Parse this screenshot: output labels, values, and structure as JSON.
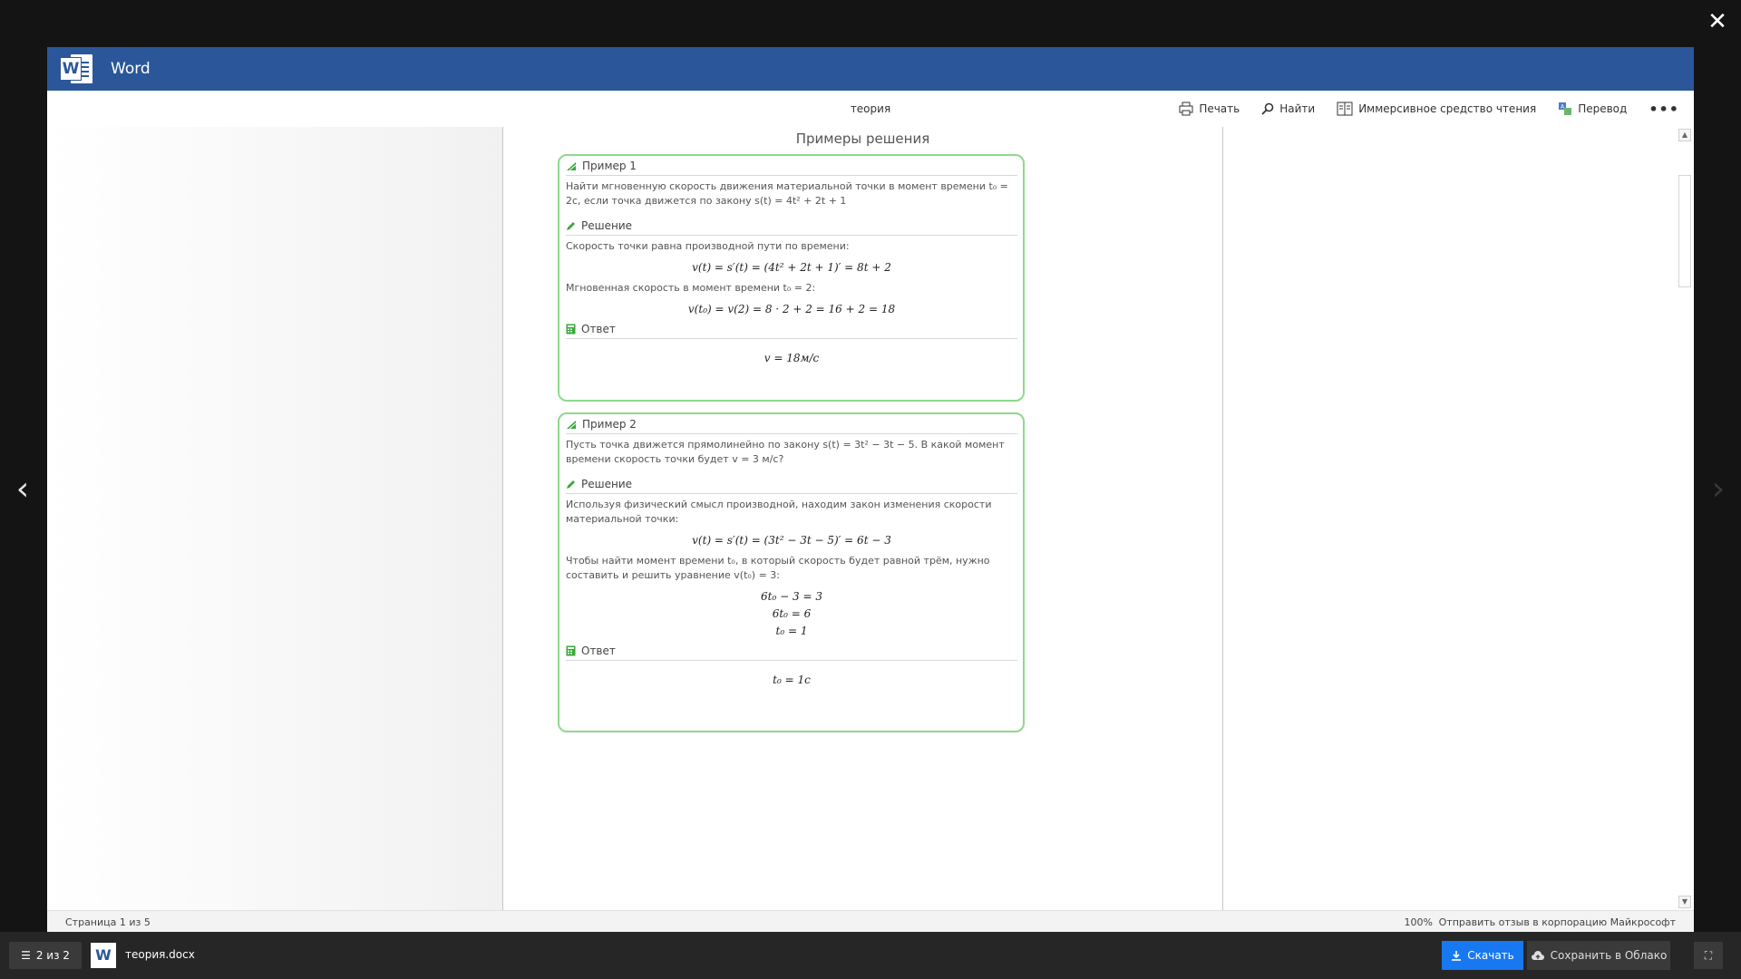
{
  "viewer": {
    "app_name": "Word",
    "doc_title": "теория",
    "toolbar": {
      "print_label": "Печать",
      "find_label": "Найти",
      "immersive_label": "Иммерсивное средство чтения",
      "translate_label": "Перевод",
      "more_label": "•••"
    }
  },
  "document": {
    "section_title": "Примеры решения",
    "example1": {
      "title": "Пример 1",
      "problem": "Найти мгновенную скорость движения материальной точки в момент времени t₀ = 2c, если точка движется по закону s(t) = 4t² + 2t + 1",
      "solution_title": "Решение",
      "step1": "Скорость точки равна производной пути по времени:",
      "formula1": "v(t) = s′(t) = (4t² + 2t + 1)′ = 8t + 2",
      "step2": "Мгновенная скорость в момент времени t₀ = 2:",
      "formula2": "v(t₀) = v(2) = 8 · 2 + 2 = 16 + 2 = 18",
      "answer_title": "Ответ",
      "answer": "v = 18м/с"
    },
    "example2": {
      "title": "Пример 2",
      "problem": "Пусть точка движется прямолинейно по закону s(t) = 3t² − 3t − 5. В какой момент времени скорость точки будет v = 3 м/с?",
      "solution_title": "Решение",
      "step1": "Используя физический смысл производной, находим закон изменения скорости материальной точки:",
      "formula1": "v(t) = s′(t) = (3t² − 3t − 5)′ = 6t − 3",
      "step2": "Чтобы найти момент времени t₀, в который скорость будет равной трём, нужно составить и решить уравнение v(t₀) = 3:",
      "eq1": "6t₀ − 3 = 3",
      "eq2": "6t₀ = 6",
      "eq3": "t₀ = 1",
      "answer_title": "Ответ",
      "answer": "t₀ = 1c"
    }
  },
  "status": {
    "page_count": "Страница 1 из 5",
    "zoom": "100%",
    "feedback": "Отправить отзыв в корпорацию Майкрософт"
  },
  "bottom": {
    "counter": "2 из 2",
    "file_name": "теория.docx",
    "download_label": "Скачать",
    "cloud_label": "Сохранить в Облако"
  },
  "colors": {
    "word_blue": "#2b579a",
    "example_border": "#8ed88e",
    "download_blue": "#1778f2"
  },
  "icons": [
    "close-icon",
    "chevron-left-icon",
    "chevron-right-icon",
    "word-logo-icon",
    "print-icon",
    "search-icon",
    "immersive-reader-icon",
    "translate-icon",
    "more-icon",
    "example-icon",
    "pencil-icon",
    "calculator-icon",
    "list-icon",
    "download-icon",
    "cloud-upload-icon",
    "fullscreen-icon"
  ]
}
